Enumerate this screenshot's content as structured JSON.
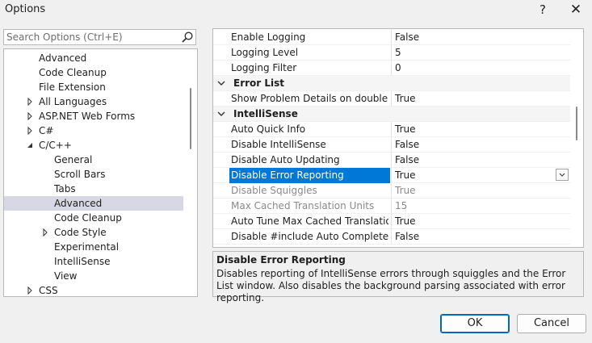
{
  "window": {
    "title": "Options",
    "help_label": "?",
    "close_label": "✕"
  },
  "search": {
    "placeholder": "Search Options (Ctrl+E)",
    "value": ""
  },
  "tree": {
    "items": [
      {
        "label": "Advanced",
        "level": 1,
        "expander": "none",
        "selected": false
      },
      {
        "label": "Code Cleanup",
        "level": 1,
        "expander": "none",
        "selected": false
      },
      {
        "label": "File Extension",
        "level": 1,
        "expander": "none",
        "selected": false
      },
      {
        "label": "All Languages",
        "level": 1,
        "expander": "collapsed",
        "selected": false
      },
      {
        "label": "ASP.NET Web Forms",
        "level": 1,
        "expander": "collapsed",
        "selected": false
      },
      {
        "label": "C#",
        "level": 1,
        "expander": "collapsed",
        "selected": false
      },
      {
        "label": "C/C++",
        "level": 1,
        "expander": "expanded",
        "selected": false
      },
      {
        "label": "General",
        "level": 2,
        "expander": "none",
        "selected": false
      },
      {
        "label": "Scroll Bars",
        "level": 2,
        "expander": "none",
        "selected": false
      },
      {
        "label": "Tabs",
        "level": 2,
        "expander": "none",
        "selected": false
      },
      {
        "label": "Advanced",
        "level": 2,
        "expander": "none",
        "selected": true
      },
      {
        "label": "Code Cleanup",
        "level": 2,
        "expander": "none",
        "selected": false
      },
      {
        "label": "Code Style",
        "level": 2,
        "expander": "collapsed",
        "selected": false
      },
      {
        "label": "Experimental",
        "level": 2,
        "expander": "none",
        "selected": false
      },
      {
        "label": "IntelliSense",
        "level": 2,
        "expander": "none",
        "selected": false
      },
      {
        "label": "View",
        "level": 2,
        "expander": "none",
        "selected": false
      },
      {
        "label": "CSS",
        "level": 1,
        "expander": "collapsed",
        "selected": false
      }
    ]
  },
  "grid": {
    "rows": [
      {
        "kind": "prop",
        "name": "Enable Logging",
        "value": "False",
        "state": "normal"
      },
      {
        "kind": "prop",
        "name": "Logging Level",
        "value": "5",
        "state": "normal"
      },
      {
        "kind": "prop",
        "name": "Logging Filter",
        "value": "0",
        "state": "normal"
      },
      {
        "kind": "category",
        "name": "Error List"
      },
      {
        "kind": "prop",
        "name": "Show Problem Details on double cli",
        "value": "True",
        "state": "normal"
      },
      {
        "kind": "category",
        "name": "IntelliSense"
      },
      {
        "kind": "prop",
        "name": "Auto Quick Info",
        "value": "True",
        "state": "normal"
      },
      {
        "kind": "prop",
        "name": "Disable IntelliSense",
        "value": "False",
        "state": "normal"
      },
      {
        "kind": "prop",
        "name": "Disable Auto Updating",
        "value": "False",
        "state": "normal"
      },
      {
        "kind": "prop",
        "name": "Disable Error Reporting",
        "value": "True",
        "state": "selected"
      },
      {
        "kind": "prop",
        "name": "Disable Squiggles",
        "value": "True",
        "state": "disabled"
      },
      {
        "kind": "prop",
        "name": "Max Cached Translation Units",
        "value": "15",
        "state": "disabled"
      },
      {
        "kind": "prop",
        "name": "Auto Tune Max Cached Translation U",
        "value": "True",
        "state": "normal"
      },
      {
        "kind": "prop",
        "name": "Disable #include Auto Complete",
        "value": "False",
        "state": "normal"
      }
    ]
  },
  "description": {
    "title": "Disable Error Reporting",
    "text": "Disables reporting of IntelliSense errors through squiggles and the Error List window.  Also disables the background parsing associated with error reporting."
  },
  "buttons": {
    "ok": "OK",
    "cancel": "Cancel"
  },
  "colors": {
    "selection": "#0078d7",
    "tree_selection": "#d8d8e4",
    "disabled_text": "#8a8a8a"
  }
}
